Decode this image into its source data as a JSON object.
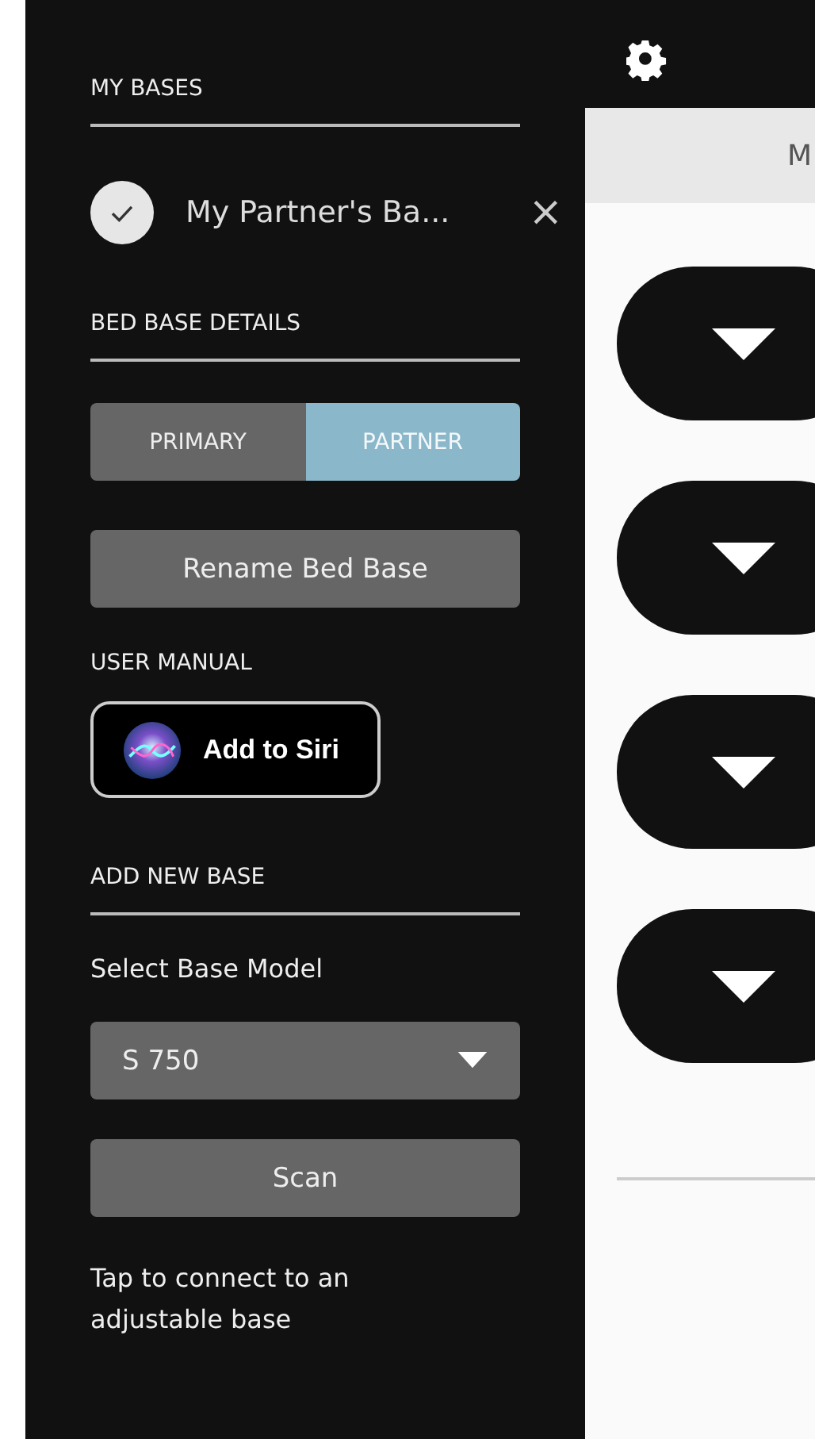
{
  "sidebar": {
    "my_bases": {
      "heading": "MY BASES",
      "items": [
        {
          "name": "My Partner's Ba...",
          "selected": true,
          "close": "×"
        }
      ]
    },
    "details": {
      "heading": "BED BASE DETAILS",
      "segments": [
        {
          "label": "PRIMARY",
          "selected": false
        },
        {
          "label": "PARTNER",
          "selected": true
        }
      ],
      "rename_button": "Rename Bed Base",
      "manual_heading": "USER MANUAL",
      "siri_button": "Add to Siri"
    },
    "add_new": {
      "heading": "ADD NEW BASE",
      "select_label": "Select Base Model",
      "select_value": "S 750",
      "scan_button": "Scan",
      "hint": "Tap to connect to an adjustable base"
    }
  },
  "main": {
    "header_title": "M"
  }
}
